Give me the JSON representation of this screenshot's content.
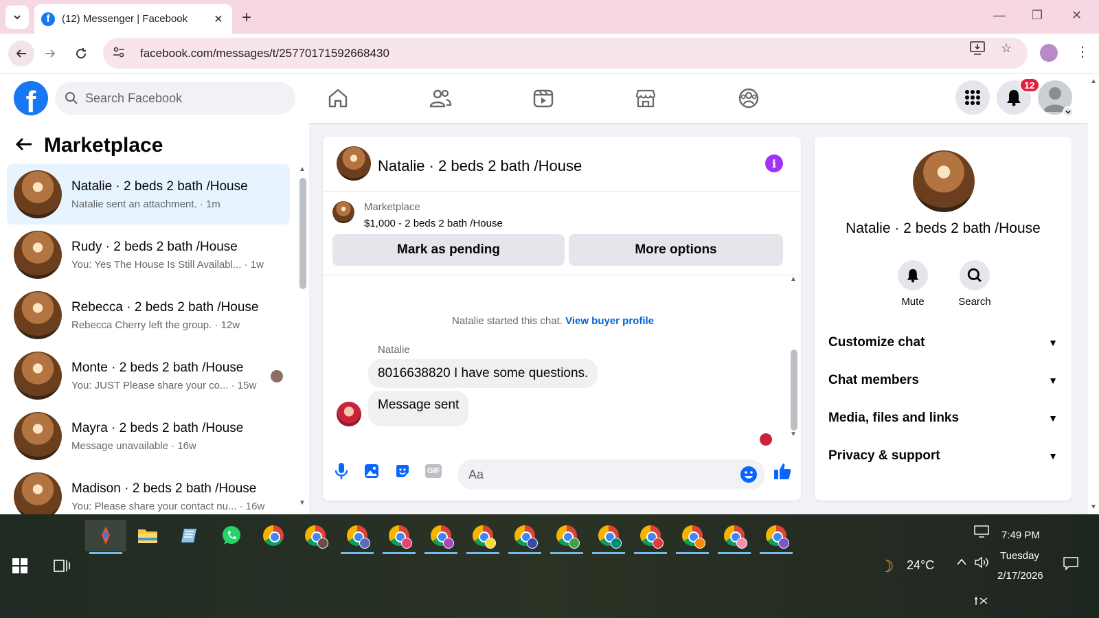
{
  "browser": {
    "tab_title": "(12) Messenger | Facebook",
    "favicon": "f",
    "new_tab": "+",
    "url": "facebook.com/messages/t/25770171592668430"
  },
  "header": {
    "logo": "f",
    "search_placeholder": "Search Facebook",
    "notification_count": "12",
    "nav": [
      "home-icon",
      "friends-icon",
      "video-icon",
      "marketplace-icon",
      "groups-icon"
    ]
  },
  "sidebar": {
    "title": "Marketplace",
    "conversations": [
      {
        "name": "Natalie · 2 beds 2 bath /House",
        "preview": "Natalie sent an attachment. · 1m",
        "active": true
      },
      {
        "name": "Rudy · 2 beds 2 bath /House",
        "preview": "You: Yes The House Is Still Availabl... · 1w"
      },
      {
        "name": "Rebecca · 2 beds 2 bath /House",
        "preview": "Rebecca Cherry left the group. · 12w"
      },
      {
        "name": "Monte · 2 beds 2 bath /House",
        "preview": "You: JUST Please share your co... · 15w"
      },
      {
        "name": "Mayra · 2 beds 2 bath /House",
        "preview": "Message unavailable · 16w"
      },
      {
        "name": "Madison · 2 beds 2 bath /House",
        "preview": "You: Please share your contact nu... · 16w"
      }
    ]
  },
  "chat": {
    "title": "Natalie · 2 beds 2 bath /House",
    "marketplace_label": "Marketplace",
    "listing": "$1,000 - 2 beds 2 bath /House",
    "mark_pending": "Mark as pending",
    "more_options": "More options",
    "started_text": "Natalie started this chat.",
    "view_profile": "View buyer profile",
    "sender": "Natalie",
    "messages": [
      "8016638820 I have some questions.",
      "Message sent"
    ],
    "composer_placeholder": "Aa",
    "gif_label": "GIF"
  },
  "info_panel": {
    "name": "Natalie · 2 beds 2 bath /House",
    "mute": "Mute",
    "search": "Search",
    "sections": [
      "Customize chat",
      "Chat members",
      "Media, files and links",
      "Privacy & support"
    ]
  },
  "taskbar": {
    "time": "7:49 PM",
    "day": "Tuesday",
    "date": "2/17/2026",
    "temperature": "24°C"
  },
  "colors": {
    "fb_blue": "#1877f2",
    "active_row": "#e7f3ff",
    "info_purple": "#a033f5",
    "badge_red": "#e41e3f",
    "tab_strip": "#f7d7e3"
  }
}
